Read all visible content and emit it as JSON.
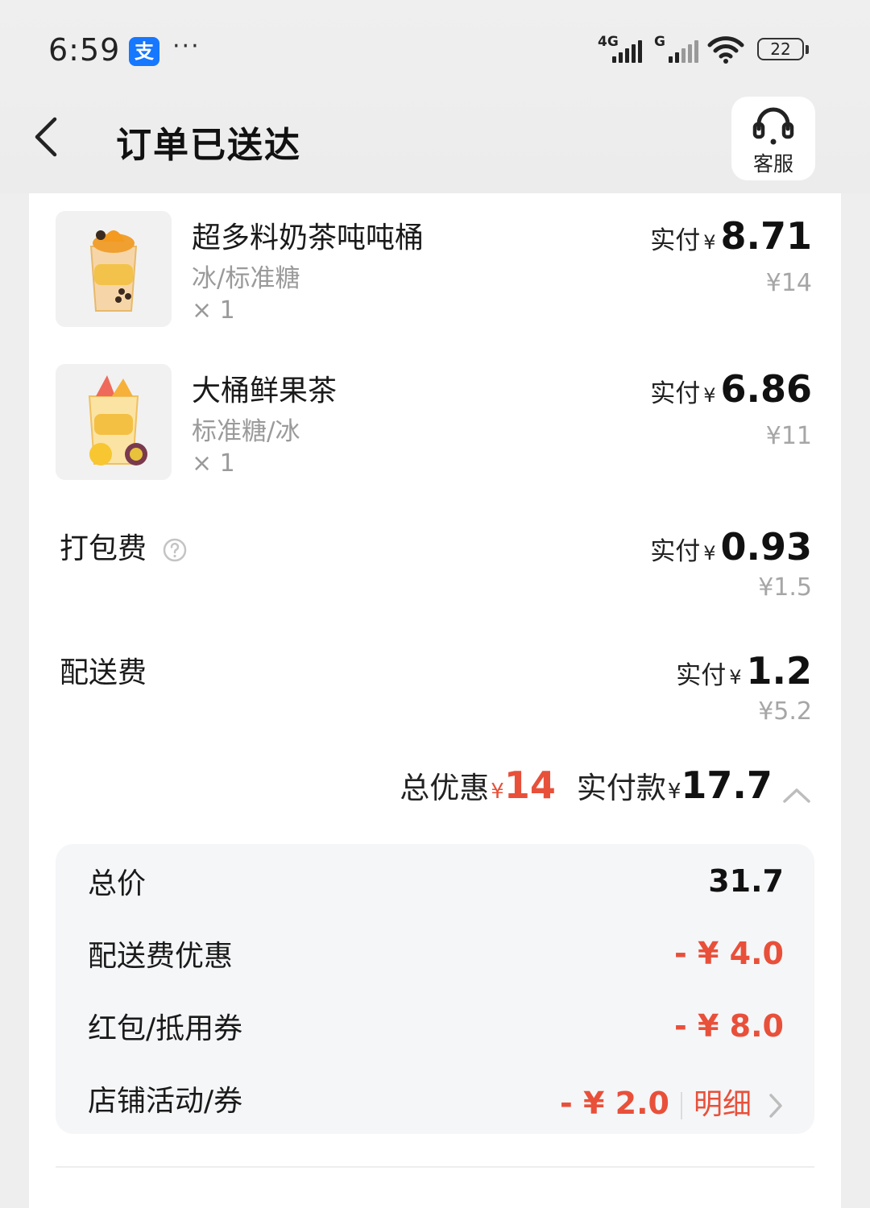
{
  "status_bar": {
    "time": "6:59",
    "app_badge": "支",
    "more": "···",
    "net1": "4G",
    "net2": "G",
    "battery": "22"
  },
  "header": {
    "title": "订单已送达",
    "service_label": "客服"
  },
  "items": [
    {
      "name": "超多料奶茶吨吨桶",
      "spec": "冰/标准糖",
      "qty": "× 1",
      "paid_label": "实付",
      "currency": "¥",
      "paid": "8.71",
      "original": "¥14"
    },
    {
      "name": "大桶鲜果茶",
      "spec": "标准糖/冰",
      "qty": "× 1",
      "paid_label": "实付",
      "currency": "¥",
      "paid": "6.86",
      "original": "¥11"
    }
  ],
  "fees": [
    {
      "label": "打包费",
      "paid_label": "实付",
      "currency": "¥",
      "paid": "0.93",
      "original": "¥1.5"
    },
    {
      "label": "配送费",
      "paid_label": "实付",
      "currency": "¥",
      "paid": "1.2",
      "original": "¥5.2"
    }
  ],
  "summary": {
    "discount_label": "总优惠",
    "discount_currency": "¥",
    "discount": "14",
    "paid_label": "实付款",
    "paid_currency": "¥",
    "paid": "17.7"
  },
  "breakdown": [
    {
      "label": "总价",
      "value": "31.7"
    },
    {
      "label": "配送费优惠",
      "value": "- ¥ 4.0"
    },
    {
      "label": "红包/抵用券",
      "value": "- ¥ 8.0"
    },
    {
      "label": "店铺活动/券",
      "value": "- ¥ 2.0",
      "detail": "明细"
    }
  ],
  "colors": {
    "accent_red": "#e8503a",
    "background": "#eeeeee",
    "card": "#ffffff",
    "breakdown_bg": "#f5f6f8",
    "alipay_blue": "#1677ff"
  }
}
